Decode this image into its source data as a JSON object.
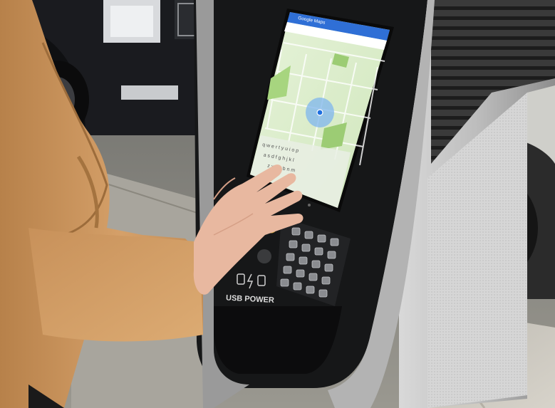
{
  "photo": {
    "kiosk": {
      "screen": {
        "app_title": "Google Maps",
        "keyboard_rows": [
          [
            "q",
            "w",
            "e",
            "r",
            "t",
            "y",
            "u",
            "i",
            "o",
            "p"
          ],
          [
            "a",
            "s",
            "d",
            "f",
            "g",
            "h",
            "j",
            "k",
            "l"
          ],
          [
            "z",
            "x",
            "c",
            "v",
            "b",
            "n",
            "m"
          ]
        ]
      },
      "usb_label": "USB POWER"
    }
  }
}
